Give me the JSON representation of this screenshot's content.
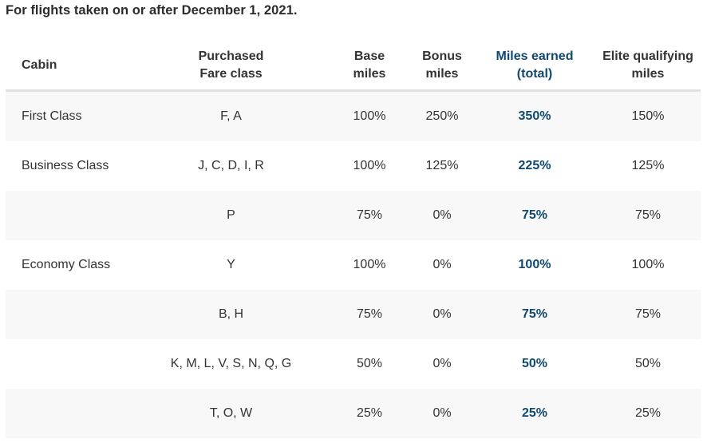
{
  "caption": "For flights taken on or after December 1, 2021.",
  "colors": {
    "accent_total": "#0f4870",
    "text": "#333333",
    "row_shade": "#f8f8f8",
    "header_rule": "#e1e1e1"
  },
  "table": {
    "headers": {
      "cabin": [
        "Cabin"
      ],
      "fare_class": [
        "Purchased",
        "Fare class"
      ],
      "base_miles": [
        "Base",
        "miles"
      ],
      "bonus_miles": [
        "Bonus",
        "miles"
      ],
      "miles_earned": [
        "Miles earned",
        "(total)"
      ],
      "elite_qualifying": [
        "Elite qualifying",
        "miles"
      ]
    },
    "rows": [
      {
        "cabin": "First Class",
        "fare_class": "F, A",
        "base": "100%",
        "bonus": "250%",
        "total": "350%",
        "elite": "150%"
      },
      {
        "cabin": "Business Class",
        "fare_class": "J, C, D, I, R",
        "base": "100%",
        "bonus": "125%",
        "total": "225%",
        "elite": "125%"
      },
      {
        "cabin": "",
        "fare_class": "P",
        "base": "75%",
        "bonus": "0%",
        "total": "75%",
        "elite": "75%"
      },
      {
        "cabin": "Economy Class",
        "fare_class": "Y",
        "base": "100%",
        "bonus": "0%",
        "total": "100%",
        "elite": "100%"
      },
      {
        "cabin": "",
        "fare_class": "B, H",
        "base": "75%",
        "bonus": "0%",
        "total": "75%",
        "elite": "75%"
      },
      {
        "cabin": "",
        "fare_class": "K, M, L, V, S, N, Q, G",
        "base": "50%",
        "bonus": "0%",
        "total": "50%",
        "elite": "50%"
      },
      {
        "cabin": "",
        "fare_class": "T, O, W",
        "base": "25%",
        "bonus": "0%",
        "total": "25%",
        "elite": "25%"
      }
    ]
  }
}
